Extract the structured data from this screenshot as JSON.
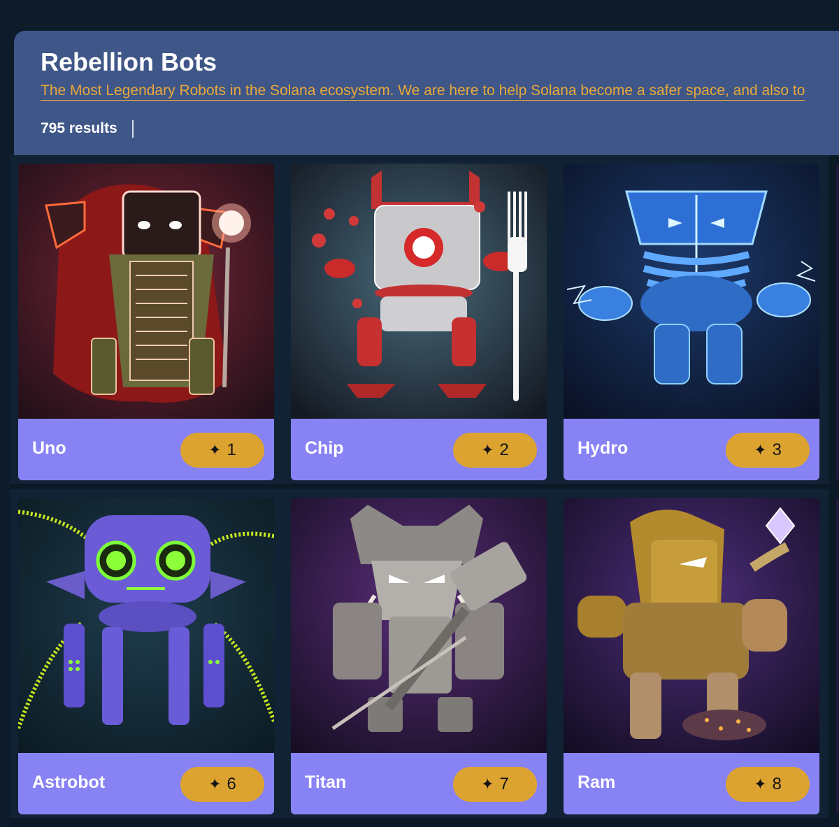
{
  "collection": {
    "title": "Rebellion Bots",
    "description": "The Most Legendary Robots in the Solana ecosystem. We are here to help Solana become a safer space, and also to",
    "results": "795 results"
  },
  "rank_icon": "sparkle-icon",
  "rank_star": "✦",
  "colors": {
    "page_background": "#0d1b2b",
    "header_background": "#3f5688",
    "description_text": "#e7a93a",
    "card_footer": "#8883f4",
    "rank_pill": "#dda331"
  },
  "cards": [
    {
      "name": "Uno",
      "rank": "1"
    },
    {
      "name": "Chip",
      "rank": "2"
    },
    {
      "name": "Hydro",
      "rank": "3"
    },
    {
      "name": "Astrobot",
      "rank": "6"
    },
    {
      "name": "Titan",
      "rank": "7"
    },
    {
      "name": "Ram",
      "rank": "8"
    }
  ]
}
